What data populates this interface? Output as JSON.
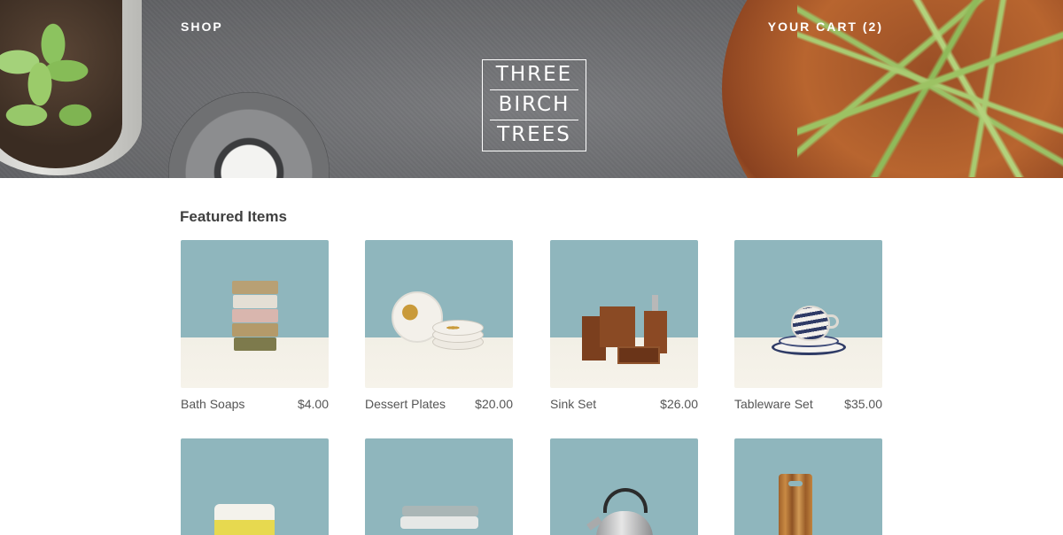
{
  "header": {
    "shop_label": "SHOP",
    "cart_label": "YOUR CART (2)",
    "logo_lines": [
      "THREE",
      "BIRCH",
      "TREES"
    ]
  },
  "section": {
    "title": "Featured Items"
  },
  "products": [
    {
      "name": "Bath Soaps",
      "price": "$4.00",
      "image": "stacked-soaps"
    },
    {
      "name": "Dessert Plates",
      "price": "$20.00",
      "image": "stacked-dessert-plates"
    },
    {
      "name": "Sink Set",
      "price": "$26.00",
      "image": "wooden-sink-set"
    },
    {
      "name": "Tableware Set",
      "price": "$35.00",
      "image": "cup-and-saucer"
    },
    {
      "name": "",
      "price": "",
      "image": "yellow-bowl"
    },
    {
      "name": "",
      "price": "",
      "image": "folded-towels"
    },
    {
      "name": "",
      "price": "",
      "image": "kettle"
    },
    {
      "name": "",
      "price": "",
      "image": "cutting-board"
    }
  ],
  "colors": {
    "tile_background": "#8fb6bd",
    "tile_surface": "#f2efe6",
    "text": "#4a4a4a"
  }
}
